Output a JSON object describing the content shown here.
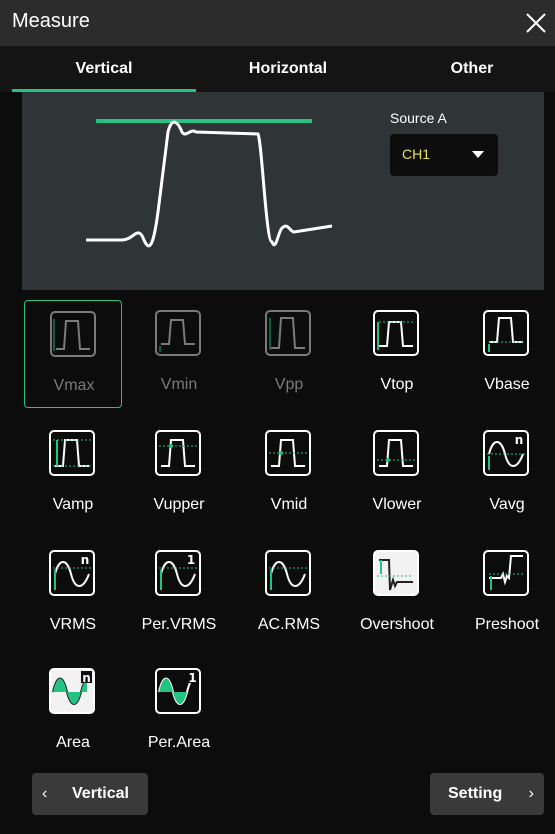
{
  "window": {
    "title": "Measure"
  },
  "tabs": [
    {
      "label": "Vertical",
      "active": true
    },
    {
      "label": "Horizontal",
      "active": false
    },
    {
      "label": "Other",
      "active": false
    }
  ],
  "source": {
    "label": "Source A",
    "value": "CH1"
  },
  "measurements": [
    {
      "label": "Vmax",
      "icon": "vmax-icon",
      "state": "selected-dim"
    },
    {
      "label": "Vmin",
      "icon": "vmin-icon",
      "state": "dim"
    },
    {
      "label": "Vpp",
      "icon": "vpp-icon",
      "state": "dim"
    },
    {
      "label": "Vtop",
      "icon": "vtop-icon",
      "state": "normal"
    },
    {
      "label": "Vbase",
      "icon": "vbase-icon",
      "state": "normal"
    },
    {
      "label": "Vamp",
      "icon": "vamp-icon",
      "state": "normal"
    },
    {
      "label": "Vupper",
      "icon": "vupper-icon",
      "state": "normal"
    },
    {
      "label": "Vmid",
      "icon": "vmid-icon",
      "state": "normal"
    },
    {
      "label": "Vlower",
      "icon": "vlower-icon",
      "state": "normal"
    },
    {
      "label": "Vavg",
      "icon": "vavg-icon",
      "state": "normal"
    },
    {
      "label": "VRMS",
      "icon": "vrms-icon",
      "state": "normal"
    },
    {
      "label": "Per.VRMS",
      "icon": "per-vrms-icon",
      "state": "normal"
    },
    {
      "label": "AC.RMS",
      "icon": "ac-rms-icon",
      "state": "normal"
    },
    {
      "label": "Overshoot",
      "icon": "overshoot-icon",
      "state": "normal"
    },
    {
      "label": "Preshoot",
      "icon": "preshoot-icon",
      "state": "normal"
    },
    {
      "label": "Area",
      "icon": "area-icon",
      "state": "normal"
    },
    {
      "label": "Per.Area",
      "icon": "per-area-icon",
      "state": "normal"
    }
  ],
  "footer": {
    "back_label": "Vertical",
    "setting_label": "Setting"
  },
  "colors": {
    "accent": "#26c281",
    "source_value": "#e8e24a",
    "dim_text": "#7a7a7a"
  }
}
